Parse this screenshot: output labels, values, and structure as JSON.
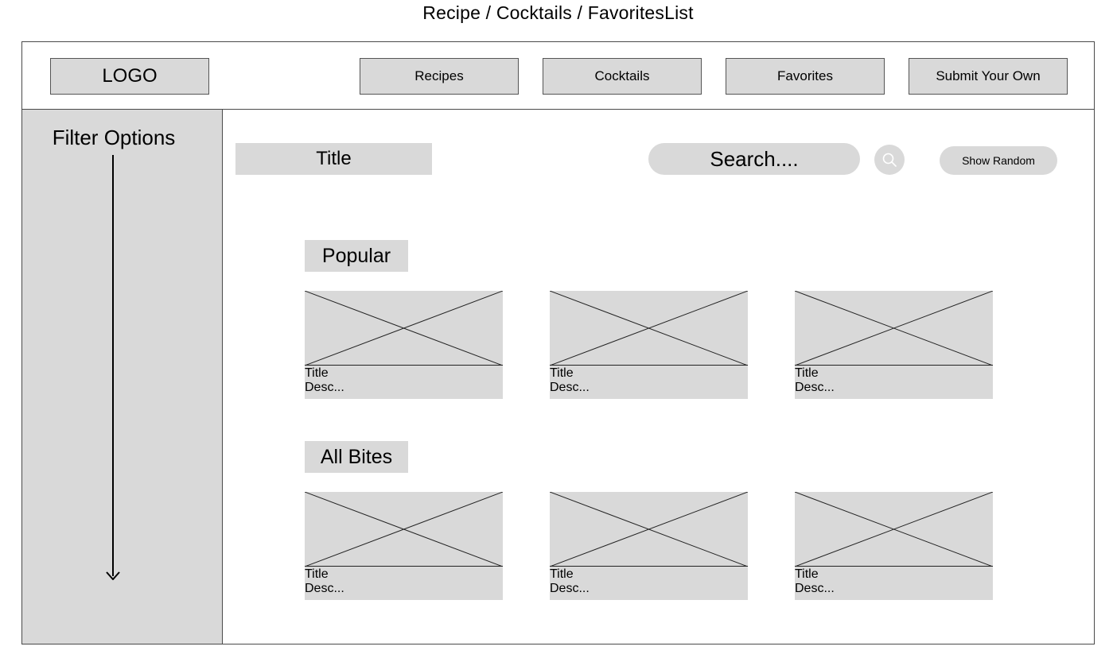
{
  "breadcrumb": "Recipe / Cocktails / FavoritesList",
  "header": {
    "logo": "LOGO",
    "nav": [
      {
        "label": "Recipes"
      },
      {
        "label": "Cocktails"
      },
      {
        "label": "Favorites"
      },
      {
        "label": "Submit Your Own"
      }
    ]
  },
  "sidebar": {
    "title": "Filter Options",
    "icon": "arrow-down-icon"
  },
  "main": {
    "title": "Title",
    "search": {
      "placeholder": "Search...."
    },
    "search_icon": "search-icon",
    "random_label": "Show Random",
    "sections": [
      {
        "label": "Popular",
        "cards": [
          {
            "title": "Title",
            "desc": "Desc..."
          },
          {
            "title": "Title",
            "desc": "Desc..."
          },
          {
            "title": "Title",
            "desc": "Desc..."
          }
        ]
      },
      {
        "label": "All Bites",
        "cards": [
          {
            "title": "Title",
            "desc": "Desc..."
          },
          {
            "title": "Title",
            "desc": "Desc..."
          },
          {
            "title": "Title",
            "desc": "Desc..."
          }
        ]
      }
    ]
  },
  "colors": {
    "placeholder_fill": "#d9d9d9",
    "border": "#4a4a4a",
    "text": "#000000"
  }
}
